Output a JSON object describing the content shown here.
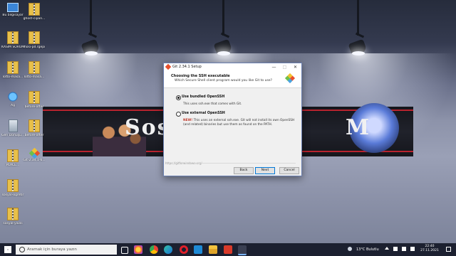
{
  "desktop": {
    "icons": [
      {
        "label": "Bu bilgisayar",
        "icon": "computer-icon"
      },
      {
        "label": "ghost-cipan...",
        "icon": "zip-icon"
      },
      {
        "label": "KASIM SÖRÜMEDNE...",
        "icon": "zip-icon"
      },
      {
        "label": "lhosi-pd.rgepi",
        "icon": "zip-icon"
      },
      {
        "label": "lotto-masa...",
        "icon": "zip-icon"
      },
      {
        "label": "Ağ",
        "icon": "network-icon"
      },
      {
        "label": "before-after",
        "icon": "zip-icon"
      },
      {
        "label": "Geri Dönüşü...",
        "icon": "recycle-bin-icon"
      },
      {
        "label": "before-after",
        "icon": "zip-icon"
      },
      {
        "label": "PLACE...",
        "icon": "zip-icon"
      },
      {
        "label": "Git-2.34.1-6...",
        "icon": "git-installer-icon"
      },
      {
        "label": "sosyal-ogretir",
        "icon": "zip-icon"
      },
      {
        "label": "sosyal-yazili",
        "icon": "zip-icon"
      }
    ],
    "wallpaper_text_left": "Sos",
    "wallpaper_text_right": "M"
  },
  "dialog": {
    "title": "Git 2.34.1 Setup",
    "minimize": "—",
    "maximize": "□",
    "close": "✕",
    "heading": "Choosing the SSH executable",
    "subheading": "Which Secure Shell client program would you like Git to use?",
    "options": [
      {
        "label": "Use bundled OpenSSH",
        "selected": true,
        "desc_line1": "This uses ssh.exe that comes with Git.",
        "desc_line2": ""
      },
      {
        "label": "Use external OpenSSH",
        "selected": false,
        "new_tag": "NEW!",
        "desc_line1": " This uses an external ssh.exe. Git will not install its own OpenSSH",
        "desc_line2": "(and related) binaries but use them as found on the PATH."
      }
    ],
    "footer_url": "https://gitforwindows.org/",
    "buttons": {
      "back": "Back",
      "next": "Next",
      "cancel": "Cancel"
    }
  },
  "taskbar": {
    "search_placeholder": "Aramak için buraya yazın",
    "apps": [
      "task-view-icon",
      "firefox-icon",
      "chrome-icon",
      "edge-icon",
      "opera-icon",
      "vscode-icon",
      "explorer-icon",
      "app-red-icon",
      "git-setup-icon"
    ],
    "weather": "13°C  Bulutlu",
    "time": "22:40",
    "date": "27.11.2021",
    "accent_color": "#0078d7"
  }
}
